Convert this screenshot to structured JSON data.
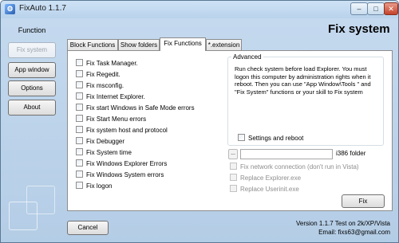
{
  "window": {
    "title": "FixAuto 1.1.7",
    "app_icon_glyph": "⚙",
    "controls": {
      "minimize": "–",
      "maximize": "□",
      "close": "✕"
    }
  },
  "sidebar": {
    "title": "Function",
    "buttons": [
      {
        "label": "Fix system",
        "active": true
      },
      {
        "label": "App window",
        "active": false
      },
      {
        "label": "Options",
        "active": false
      },
      {
        "label": "About",
        "active": false
      }
    ]
  },
  "header": {
    "title": "Fix system"
  },
  "tabs": [
    {
      "label": "Block Functions",
      "active": false
    },
    {
      "label": "Show folders",
      "active": false
    },
    {
      "label": "Fix Functions",
      "active": true
    },
    {
      "label": "*.extension",
      "active": false
    }
  ],
  "fix_items": [
    "Fix Task Manager.",
    "Fix Regedit.",
    "Fix msconfig.",
    "Fix Internet Explorer.",
    "Fix start Windows in Safe Mode errors",
    "Fix Start Menu errors",
    "Fix system host and protocol",
    "Fix Debugger",
    "Fix System time",
    "Fix Windows Explorer Errors",
    "Fix Windows System errors",
    "Fix logon"
  ],
  "advanced": {
    "legend": "Advanced",
    "description": "Run check system before load Explorer. You must logon this computer by administration rights when it reboot. Then you can use \"App Window\\Tools \" and \"Fix System\" functions or your skill to Fix system",
    "settings_reboot_label": "Settings and reboot"
  },
  "folder": {
    "browse_label": "...",
    "path_value": "",
    "label": "i386 folder"
  },
  "disabled_options": [
    "Fix network connection (don't run in Vista)",
    "Replace Explorer.exe",
    "Replace Userinit.exe"
  ],
  "actions": {
    "fix": "Fix",
    "cancel": "Cancel"
  },
  "footer": {
    "version": "Version 1.1.7 Test on 2k/XP/Vista",
    "email": "Email: fixs63@gmail.com"
  }
}
